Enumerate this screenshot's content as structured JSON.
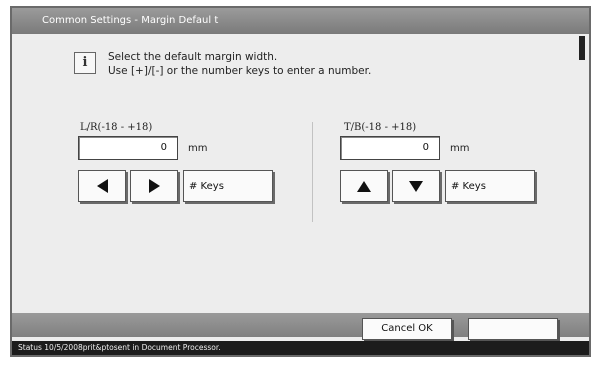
{
  "title": "Common Settings - Margin Defaul t",
  "message": {
    "line1": "Select the default margin width.",
    "line2": "Use [+]/[-] or the number keys to enter a number."
  },
  "lr": {
    "label": "L/R(-18 - +18)",
    "value": "0",
    "unit": "mm",
    "keys_label": "# Keys",
    "left_icon": "left-arrow",
    "right_icon": "right-arrow"
  },
  "tb": {
    "label": "T/B(-18 - +18)",
    "value": "0",
    "unit": "mm",
    "keys_label": "# Keys",
    "up_icon": "up-arrow",
    "down_icon": "down-arrow"
  },
  "footer": {
    "cancel_ok_label": "Cancel OK",
    "empty_label": ""
  },
  "status": {
    "text": "Status 10/5/2008prit&ptosent in Document Processor."
  }
}
